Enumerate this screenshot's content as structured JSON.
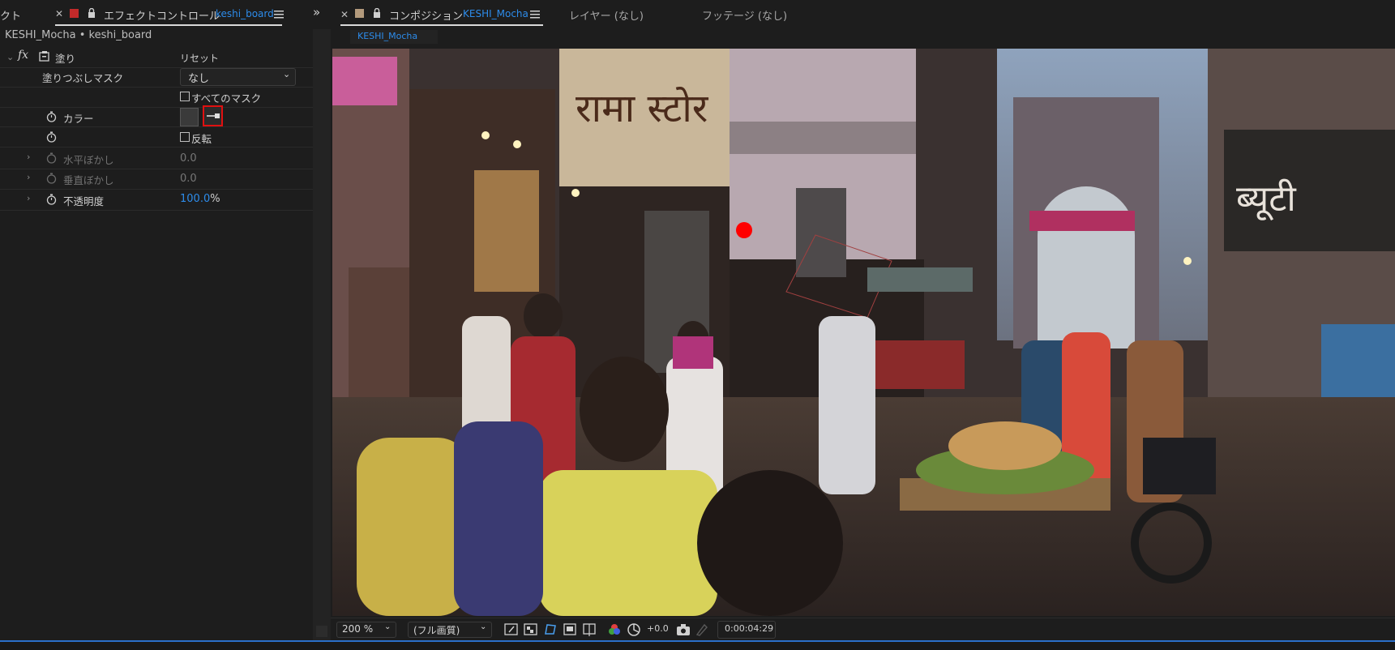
{
  "left_panel": {
    "partial_tab_label": "クト",
    "tab_label": "エフェクトコントロール",
    "tab_layer": "keshi_board",
    "layer_path": "KESHI_Mocha • keshi_board",
    "effect": {
      "name": "塗り",
      "reset_label": "リセット",
      "mask_label": "塗りつぶしマスク",
      "mask_value": "なし",
      "all_masks_label": "すべてのマスク",
      "color_label": "カラー",
      "invert_label": "反転",
      "h_blur_label": "水平ぼかし",
      "h_blur_value": "0.0",
      "v_blur_label": "垂直ぼかし",
      "v_blur_value": "0.0",
      "opacity_label": "不透明度",
      "opacity_value": "100.0",
      "opacity_unit": "%"
    }
  },
  "composition_panel": {
    "tab_label": "コンポジション",
    "comp_name": "KESHI_Mocha",
    "layer_tab": "レイヤー (なし)",
    "footage_tab": "フッテージ (なし)",
    "subtab": "KESHI_Mocha"
  },
  "toolbar": {
    "zoom": "200 %",
    "quality": "(フル画質)",
    "exposure": "+0.0",
    "timecode": "0:00:04:29"
  },
  "colors": {
    "accent_blue": "#2d8ceb",
    "highlight_red": "#e01010",
    "panel_bg": "#1d1d1d",
    "marker_red": "#ff0000"
  }
}
